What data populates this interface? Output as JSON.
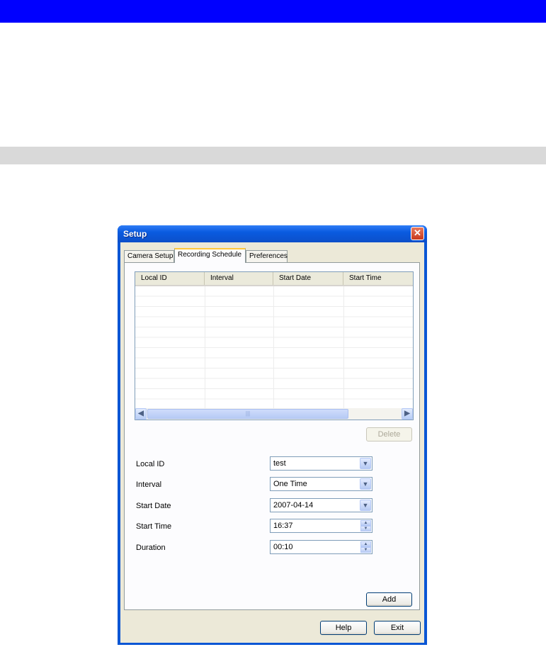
{
  "dialog": {
    "title": "Setup",
    "close_glyph": "✕"
  },
  "tabs": [
    {
      "label": "Camera Setup",
      "active": false
    },
    {
      "label": "Recording Schedule",
      "active": true
    },
    {
      "label": "Preferences",
      "active": false
    }
  ],
  "schedule_list": {
    "columns": [
      "Local ID",
      "Interval",
      "Start Date",
      "Start Time"
    ],
    "rows": []
  },
  "buttons": {
    "delete": "Delete",
    "add": "Add",
    "help": "Help",
    "exit": "Exit"
  },
  "form": {
    "local_id": {
      "label": "Local ID",
      "value": "test"
    },
    "interval": {
      "label": "Interval",
      "value": "One Time"
    },
    "start_date": {
      "label": "Start Date",
      "value": "2007-04-14"
    },
    "start_time": {
      "label": "Start Time",
      "value": "16:37"
    },
    "duration": {
      "label": "Duration",
      "value": "00:10"
    }
  },
  "icons": {
    "dropdown": "chevron-down-icon",
    "spin_up": "arrow-up-icon",
    "spin_down": "arrow-down-icon",
    "scroll_left": "arrow-left-icon",
    "scroll_right": "arrow-right-icon"
  },
  "colors": {
    "top_band": "#0000ff",
    "section_band": "#d9d9d9",
    "title_bar": "#0a5be0",
    "dialog_face": "#ece9d8"
  }
}
